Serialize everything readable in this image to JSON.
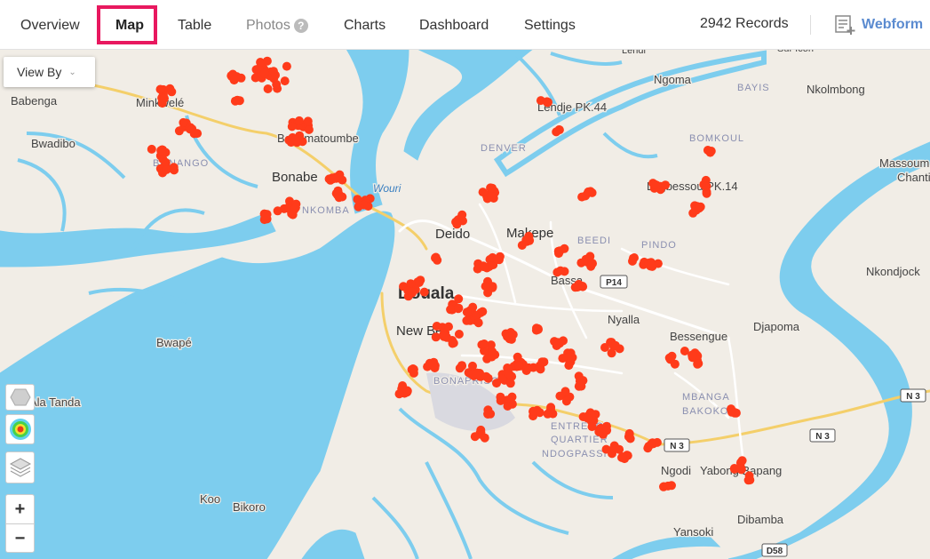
{
  "nav": {
    "tabs": [
      {
        "label": "Overview"
      },
      {
        "label": "Map"
      },
      {
        "label": "Table"
      },
      {
        "label": "Photos"
      },
      {
        "label": "Charts"
      },
      {
        "label": "Dashboard"
      },
      {
        "label": "Settings"
      }
    ],
    "photos_help": "?",
    "records": "2942 Records",
    "webform": "Webform"
  },
  "map": {
    "view_by": "View By",
    "zoom_in": "+",
    "zoom_out": "−",
    "water_color": "#7dcdee",
    "land_color": "#f1ede6",
    "point_color": "#ff3b1a",
    "places": {
      "babenga": "Babenga",
      "minkwele": "Minkwelé",
      "bwadibo": "Bwadibo",
      "bonamatoumbe": "Bonamatoumbe",
      "bonabe": "Bonabe",
      "bongo": "BONANGO",
      "nkomba": "NKOMBA",
      "wouri": "Wouri",
      "denver": "DENVER",
      "deido": "Deido",
      "makepe": "Makepe",
      "beedi": "BEEDI",
      "pindo": "PINDO",
      "bassa": "Bassa",
      "douala": "Douala",
      "new_bell": "New Bell",
      "nyalla": "Nyalla",
      "bonaberi_airport": "BONAPRISO",
      "bwape": "Bwapé",
      "ala_tanda": "Ala Tanda",
      "ngoma": "Ngoma",
      "bayis": "BAYIS",
      "nkolmbong": "Nkolmbong",
      "bomkoul": "BOMKOUL",
      "logbessou": "Logbessou PK.14",
      "pk44": "Lendje PK.44",
      "massoumbou": "Massoum",
      "chanti": "Chanti",
      "nkondjock": "Nkondjock",
      "djapoma": "Djapoma",
      "bessengue": "Bessengue",
      "mbanga": "MBANGA",
      "bakoko": "BAKOKO",
      "ngodi": "Ngodi",
      "yabong": "Yabong Bapang",
      "dibamba": "Dibamba",
      "yansoki": "Yansoki",
      "entrepot": "ENTREPOT",
      "quartier": "QUARTIER",
      "ndogpassi": "NDOGPASSI",
      "koo": "Koo",
      "bikoro": "Bikoro",
      "lendi": "Lendi",
      "sur_icon": "Sur Icon"
    },
    "roads": {
      "p14": "P14",
      "n3a": "N 3",
      "n3b": "N 3",
      "n3c": "N 3",
      "d58": "D58"
    }
  }
}
